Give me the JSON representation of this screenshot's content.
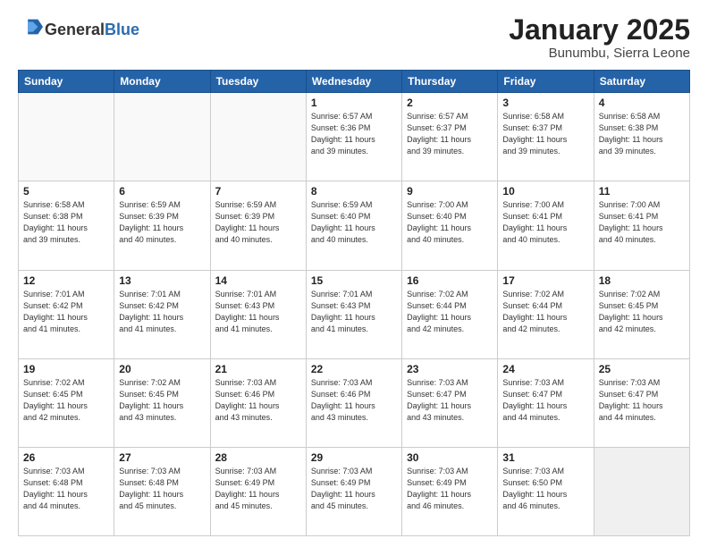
{
  "header": {
    "logo_general": "General",
    "logo_blue": "Blue",
    "title": "January 2025",
    "subtitle": "Bunumbu, Sierra Leone"
  },
  "days_of_week": [
    "Sunday",
    "Monday",
    "Tuesday",
    "Wednesday",
    "Thursday",
    "Friday",
    "Saturday"
  ],
  "weeks": [
    [
      {
        "day": "",
        "info": ""
      },
      {
        "day": "",
        "info": ""
      },
      {
        "day": "",
        "info": ""
      },
      {
        "day": "1",
        "info": "Sunrise: 6:57 AM\nSunset: 6:36 PM\nDaylight: 11 hours\nand 39 minutes."
      },
      {
        "day": "2",
        "info": "Sunrise: 6:57 AM\nSunset: 6:37 PM\nDaylight: 11 hours\nand 39 minutes."
      },
      {
        "day": "3",
        "info": "Sunrise: 6:58 AM\nSunset: 6:37 PM\nDaylight: 11 hours\nand 39 minutes."
      },
      {
        "day": "4",
        "info": "Sunrise: 6:58 AM\nSunset: 6:38 PM\nDaylight: 11 hours\nand 39 minutes."
      }
    ],
    [
      {
        "day": "5",
        "info": "Sunrise: 6:58 AM\nSunset: 6:38 PM\nDaylight: 11 hours\nand 39 minutes."
      },
      {
        "day": "6",
        "info": "Sunrise: 6:59 AM\nSunset: 6:39 PM\nDaylight: 11 hours\nand 40 minutes."
      },
      {
        "day": "7",
        "info": "Sunrise: 6:59 AM\nSunset: 6:39 PM\nDaylight: 11 hours\nand 40 minutes."
      },
      {
        "day": "8",
        "info": "Sunrise: 6:59 AM\nSunset: 6:40 PM\nDaylight: 11 hours\nand 40 minutes."
      },
      {
        "day": "9",
        "info": "Sunrise: 7:00 AM\nSunset: 6:40 PM\nDaylight: 11 hours\nand 40 minutes."
      },
      {
        "day": "10",
        "info": "Sunrise: 7:00 AM\nSunset: 6:41 PM\nDaylight: 11 hours\nand 40 minutes."
      },
      {
        "day": "11",
        "info": "Sunrise: 7:00 AM\nSunset: 6:41 PM\nDaylight: 11 hours\nand 40 minutes."
      }
    ],
    [
      {
        "day": "12",
        "info": "Sunrise: 7:01 AM\nSunset: 6:42 PM\nDaylight: 11 hours\nand 41 minutes."
      },
      {
        "day": "13",
        "info": "Sunrise: 7:01 AM\nSunset: 6:42 PM\nDaylight: 11 hours\nand 41 minutes."
      },
      {
        "day": "14",
        "info": "Sunrise: 7:01 AM\nSunset: 6:43 PM\nDaylight: 11 hours\nand 41 minutes."
      },
      {
        "day": "15",
        "info": "Sunrise: 7:01 AM\nSunset: 6:43 PM\nDaylight: 11 hours\nand 41 minutes."
      },
      {
        "day": "16",
        "info": "Sunrise: 7:02 AM\nSunset: 6:44 PM\nDaylight: 11 hours\nand 42 minutes."
      },
      {
        "day": "17",
        "info": "Sunrise: 7:02 AM\nSunset: 6:44 PM\nDaylight: 11 hours\nand 42 minutes."
      },
      {
        "day": "18",
        "info": "Sunrise: 7:02 AM\nSunset: 6:45 PM\nDaylight: 11 hours\nand 42 minutes."
      }
    ],
    [
      {
        "day": "19",
        "info": "Sunrise: 7:02 AM\nSunset: 6:45 PM\nDaylight: 11 hours\nand 42 minutes."
      },
      {
        "day": "20",
        "info": "Sunrise: 7:02 AM\nSunset: 6:45 PM\nDaylight: 11 hours\nand 43 minutes."
      },
      {
        "day": "21",
        "info": "Sunrise: 7:03 AM\nSunset: 6:46 PM\nDaylight: 11 hours\nand 43 minutes."
      },
      {
        "day": "22",
        "info": "Sunrise: 7:03 AM\nSunset: 6:46 PM\nDaylight: 11 hours\nand 43 minutes."
      },
      {
        "day": "23",
        "info": "Sunrise: 7:03 AM\nSunset: 6:47 PM\nDaylight: 11 hours\nand 43 minutes."
      },
      {
        "day": "24",
        "info": "Sunrise: 7:03 AM\nSunset: 6:47 PM\nDaylight: 11 hours\nand 44 minutes."
      },
      {
        "day": "25",
        "info": "Sunrise: 7:03 AM\nSunset: 6:47 PM\nDaylight: 11 hours\nand 44 minutes."
      }
    ],
    [
      {
        "day": "26",
        "info": "Sunrise: 7:03 AM\nSunset: 6:48 PM\nDaylight: 11 hours\nand 44 minutes."
      },
      {
        "day": "27",
        "info": "Sunrise: 7:03 AM\nSunset: 6:48 PM\nDaylight: 11 hours\nand 45 minutes."
      },
      {
        "day": "28",
        "info": "Sunrise: 7:03 AM\nSunset: 6:49 PM\nDaylight: 11 hours\nand 45 minutes."
      },
      {
        "day": "29",
        "info": "Sunrise: 7:03 AM\nSunset: 6:49 PM\nDaylight: 11 hours\nand 45 minutes."
      },
      {
        "day": "30",
        "info": "Sunrise: 7:03 AM\nSunset: 6:49 PM\nDaylight: 11 hours\nand 46 minutes."
      },
      {
        "day": "31",
        "info": "Sunrise: 7:03 AM\nSunset: 6:50 PM\nDaylight: 11 hours\nand 46 minutes."
      },
      {
        "day": "",
        "info": ""
      }
    ]
  ]
}
